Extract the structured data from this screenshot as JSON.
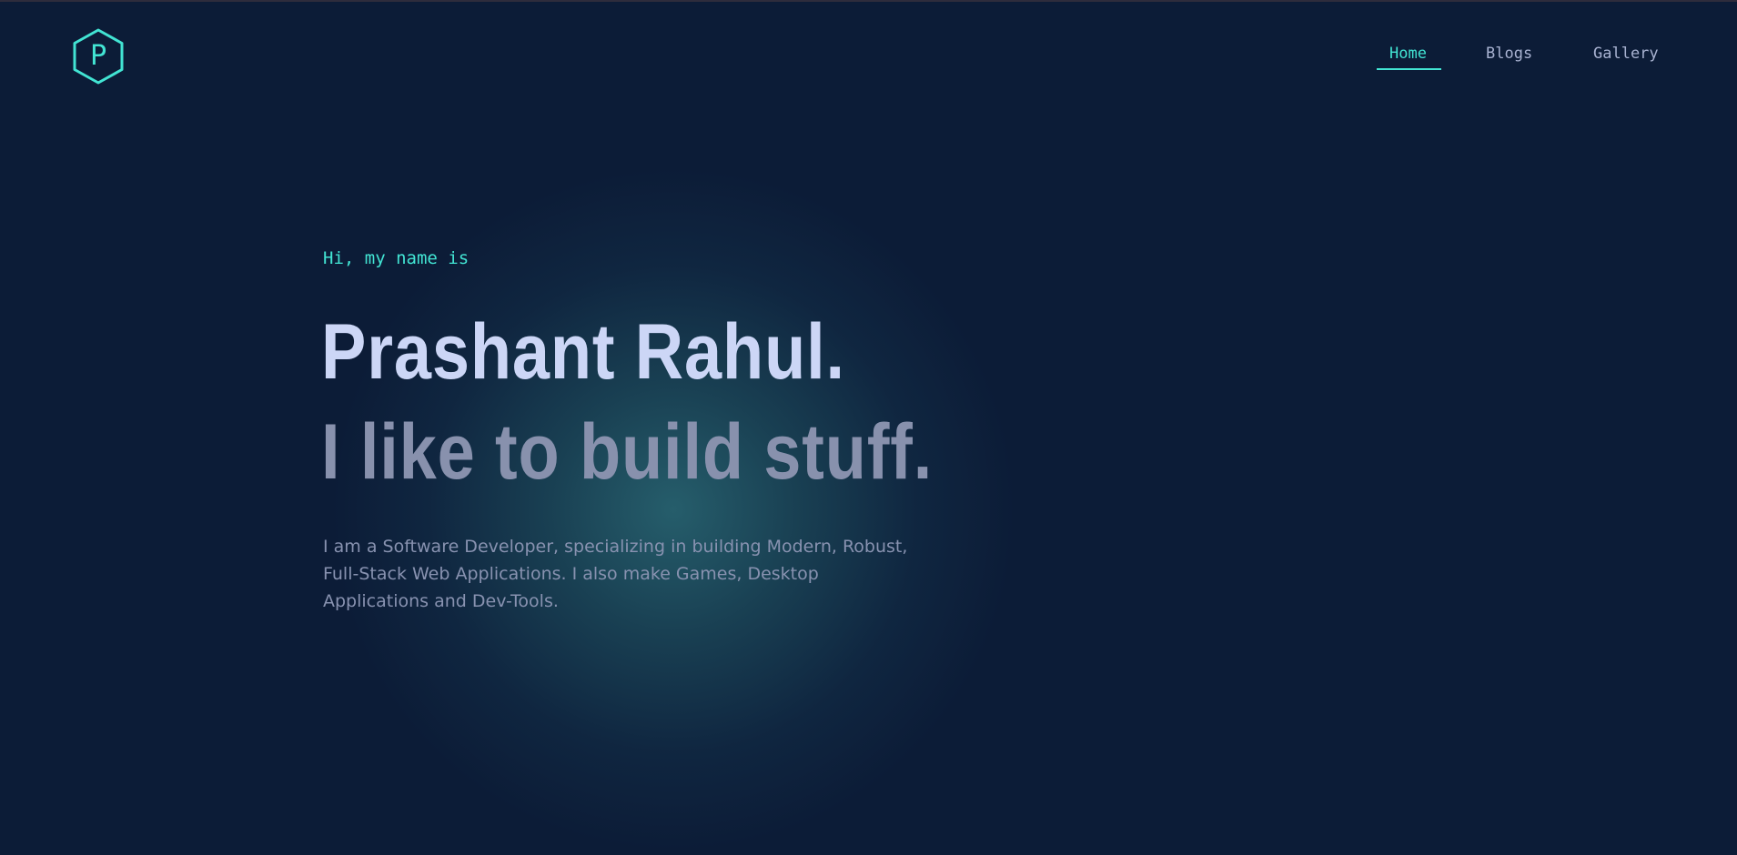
{
  "header": {
    "logo_letter": "P",
    "nav": [
      {
        "label": "Home",
        "active": true
      },
      {
        "label": "Blogs",
        "active": false
      },
      {
        "label": "Gallery",
        "active": false
      }
    ]
  },
  "hero": {
    "intro": "Hi, my name is",
    "name": "Prashant Rahul.",
    "tagline": "I like to build stuff.",
    "bio": "I am a Software Developer, specializing in building Modern, Robust, Full-Stack Web Applications. I also make Games, Desktop Applications and Dev-Tools."
  },
  "colors": {
    "background": "#0c1c37",
    "accent": "#42e4d3",
    "heading": "#ccd6f6",
    "subheading": "#8891ad",
    "body_text": "#8892b0"
  },
  "icons": {
    "logo": "hexagon-logo-icon"
  }
}
